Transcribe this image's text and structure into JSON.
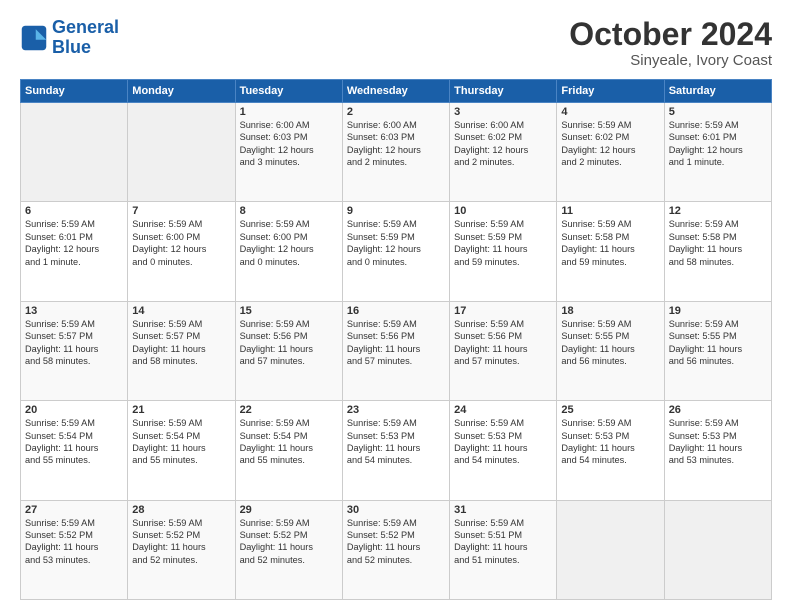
{
  "header": {
    "logo_line1": "General",
    "logo_line2": "Blue",
    "title": "October 2024",
    "subtitle": "Sinyeale, Ivory Coast"
  },
  "calendar": {
    "headers": [
      "Sunday",
      "Monday",
      "Tuesday",
      "Wednesday",
      "Thursday",
      "Friday",
      "Saturday"
    ],
    "weeks": [
      [
        {
          "day": "",
          "info": ""
        },
        {
          "day": "",
          "info": ""
        },
        {
          "day": "1",
          "info": "Sunrise: 6:00 AM\nSunset: 6:03 PM\nDaylight: 12 hours\nand 3 minutes."
        },
        {
          "day": "2",
          "info": "Sunrise: 6:00 AM\nSunset: 6:03 PM\nDaylight: 12 hours\nand 2 minutes."
        },
        {
          "day": "3",
          "info": "Sunrise: 6:00 AM\nSunset: 6:02 PM\nDaylight: 12 hours\nand 2 minutes."
        },
        {
          "day": "4",
          "info": "Sunrise: 5:59 AM\nSunset: 6:02 PM\nDaylight: 12 hours\nand 2 minutes."
        },
        {
          "day": "5",
          "info": "Sunrise: 5:59 AM\nSunset: 6:01 PM\nDaylight: 12 hours\nand 1 minute."
        }
      ],
      [
        {
          "day": "6",
          "info": "Sunrise: 5:59 AM\nSunset: 6:01 PM\nDaylight: 12 hours\nand 1 minute."
        },
        {
          "day": "7",
          "info": "Sunrise: 5:59 AM\nSunset: 6:00 PM\nDaylight: 12 hours\nand 0 minutes."
        },
        {
          "day": "8",
          "info": "Sunrise: 5:59 AM\nSunset: 6:00 PM\nDaylight: 12 hours\nand 0 minutes."
        },
        {
          "day": "9",
          "info": "Sunrise: 5:59 AM\nSunset: 5:59 PM\nDaylight: 12 hours\nand 0 minutes."
        },
        {
          "day": "10",
          "info": "Sunrise: 5:59 AM\nSunset: 5:59 PM\nDaylight: 11 hours\nand 59 minutes."
        },
        {
          "day": "11",
          "info": "Sunrise: 5:59 AM\nSunset: 5:58 PM\nDaylight: 11 hours\nand 59 minutes."
        },
        {
          "day": "12",
          "info": "Sunrise: 5:59 AM\nSunset: 5:58 PM\nDaylight: 11 hours\nand 58 minutes."
        }
      ],
      [
        {
          "day": "13",
          "info": "Sunrise: 5:59 AM\nSunset: 5:57 PM\nDaylight: 11 hours\nand 58 minutes."
        },
        {
          "day": "14",
          "info": "Sunrise: 5:59 AM\nSunset: 5:57 PM\nDaylight: 11 hours\nand 58 minutes."
        },
        {
          "day": "15",
          "info": "Sunrise: 5:59 AM\nSunset: 5:56 PM\nDaylight: 11 hours\nand 57 minutes."
        },
        {
          "day": "16",
          "info": "Sunrise: 5:59 AM\nSunset: 5:56 PM\nDaylight: 11 hours\nand 57 minutes."
        },
        {
          "day": "17",
          "info": "Sunrise: 5:59 AM\nSunset: 5:56 PM\nDaylight: 11 hours\nand 57 minutes."
        },
        {
          "day": "18",
          "info": "Sunrise: 5:59 AM\nSunset: 5:55 PM\nDaylight: 11 hours\nand 56 minutes."
        },
        {
          "day": "19",
          "info": "Sunrise: 5:59 AM\nSunset: 5:55 PM\nDaylight: 11 hours\nand 56 minutes."
        }
      ],
      [
        {
          "day": "20",
          "info": "Sunrise: 5:59 AM\nSunset: 5:54 PM\nDaylight: 11 hours\nand 55 minutes."
        },
        {
          "day": "21",
          "info": "Sunrise: 5:59 AM\nSunset: 5:54 PM\nDaylight: 11 hours\nand 55 minutes."
        },
        {
          "day": "22",
          "info": "Sunrise: 5:59 AM\nSunset: 5:54 PM\nDaylight: 11 hours\nand 55 minutes."
        },
        {
          "day": "23",
          "info": "Sunrise: 5:59 AM\nSunset: 5:53 PM\nDaylight: 11 hours\nand 54 minutes."
        },
        {
          "day": "24",
          "info": "Sunrise: 5:59 AM\nSunset: 5:53 PM\nDaylight: 11 hours\nand 54 minutes."
        },
        {
          "day": "25",
          "info": "Sunrise: 5:59 AM\nSunset: 5:53 PM\nDaylight: 11 hours\nand 54 minutes."
        },
        {
          "day": "26",
          "info": "Sunrise: 5:59 AM\nSunset: 5:53 PM\nDaylight: 11 hours\nand 53 minutes."
        }
      ],
      [
        {
          "day": "27",
          "info": "Sunrise: 5:59 AM\nSunset: 5:52 PM\nDaylight: 11 hours\nand 53 minutes."
        },
        {
          "day": "28",
          "info": "Sunrise: 5:59 AM\nSunset: 5:52 PM\nDaylight: 11 hours\nand 52 minutes."
        },
        {
          "day": "29",
          "info": "Sunrise: 5:59 AM\nSunset: 5:52 PM\nDaylight: 11 hours\nand 52 minutes."
        },
        {
          "day": "30",
          "info": "Sunrise: 5:59 AM\nSunset: 5:52 PM\nDaylight: 11 hours\nand 52 minutes."
        },
        {
          "day": "31",
          "info": "Sunrise: 5:59 AM\nSunset: 5:51 PM\nDaylight: 11 hours\nand 51 minutes."
        },
        {
          "day": "",
          "info": ""
        },
        {
          "day": "",
          "info": ""
        }
      ]
    ]
  }
}
